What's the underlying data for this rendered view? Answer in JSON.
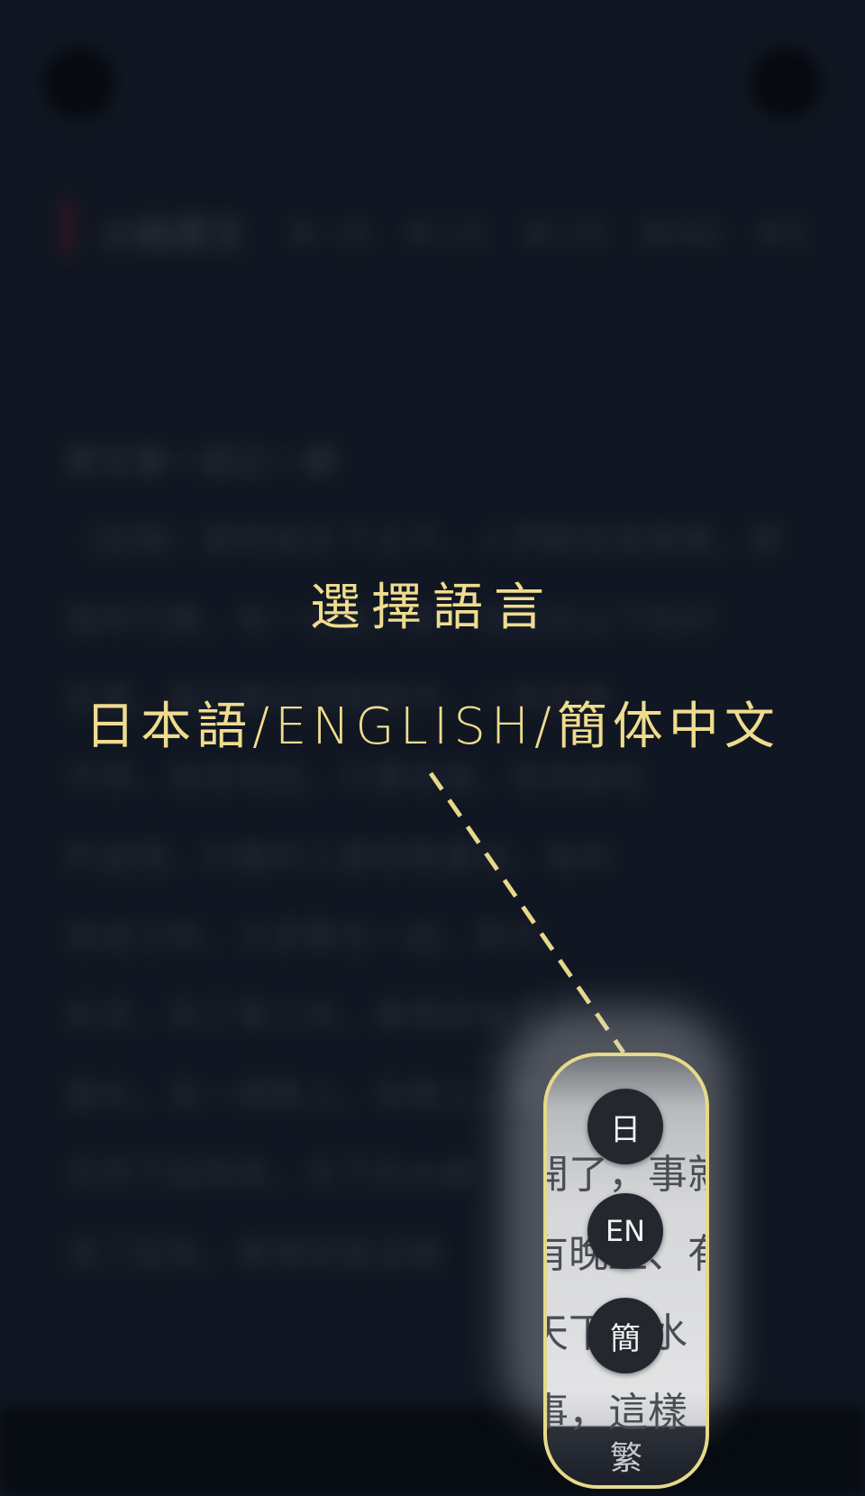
{
  "background": {
    "section_title": "小說原文",
    "tabs": [
      "第一回",
      "第二回",
      "第三回",
      "第四回",
      "第五"
    ],
    "heading": "原文第一回之一節",
    "body_lines": [
      "（前略）那時候天下太平，人們都安居樂業，那",
      "個年代裏，有一位老人家，他住在山下的村",
      "莊裏，每日都在田間勞作，一年四季",
      "不停，他常常說，只要肯做，就有飯吃",
      "的道理，村裏的人都很敬重他，每到",
      "收成之時，大家聚在一起，對天",
      "祈求，到了第二年，事情就有了",
      "變化，有一個晚上，有晚上，天",
      "忽然下起雨來，天下的水都",
      "漲了起來，事情就是這樣"
    ]
  },
  "overlay": {
    "title": "選擇語言",
    "subtitle": "日本語/ENGLISH/簡体中文",
    "pointer_color": "#e8d98a"
  },
  "language_switcher": {
    "peek_lines": [
      "",
      "開了，事就",
      "有晚上、有",
      "天下的水",
      "事，這樣"
    ],
    "buttons": [
      {
        "code": "ja",
        "label": "日"
      },
      {
        "code": "en",
        "label": "EN"
      },
      {
        "code": "zh-hans",
        "label": "簡"
      }
    ],
    "current_label": "繁"
  }
}
